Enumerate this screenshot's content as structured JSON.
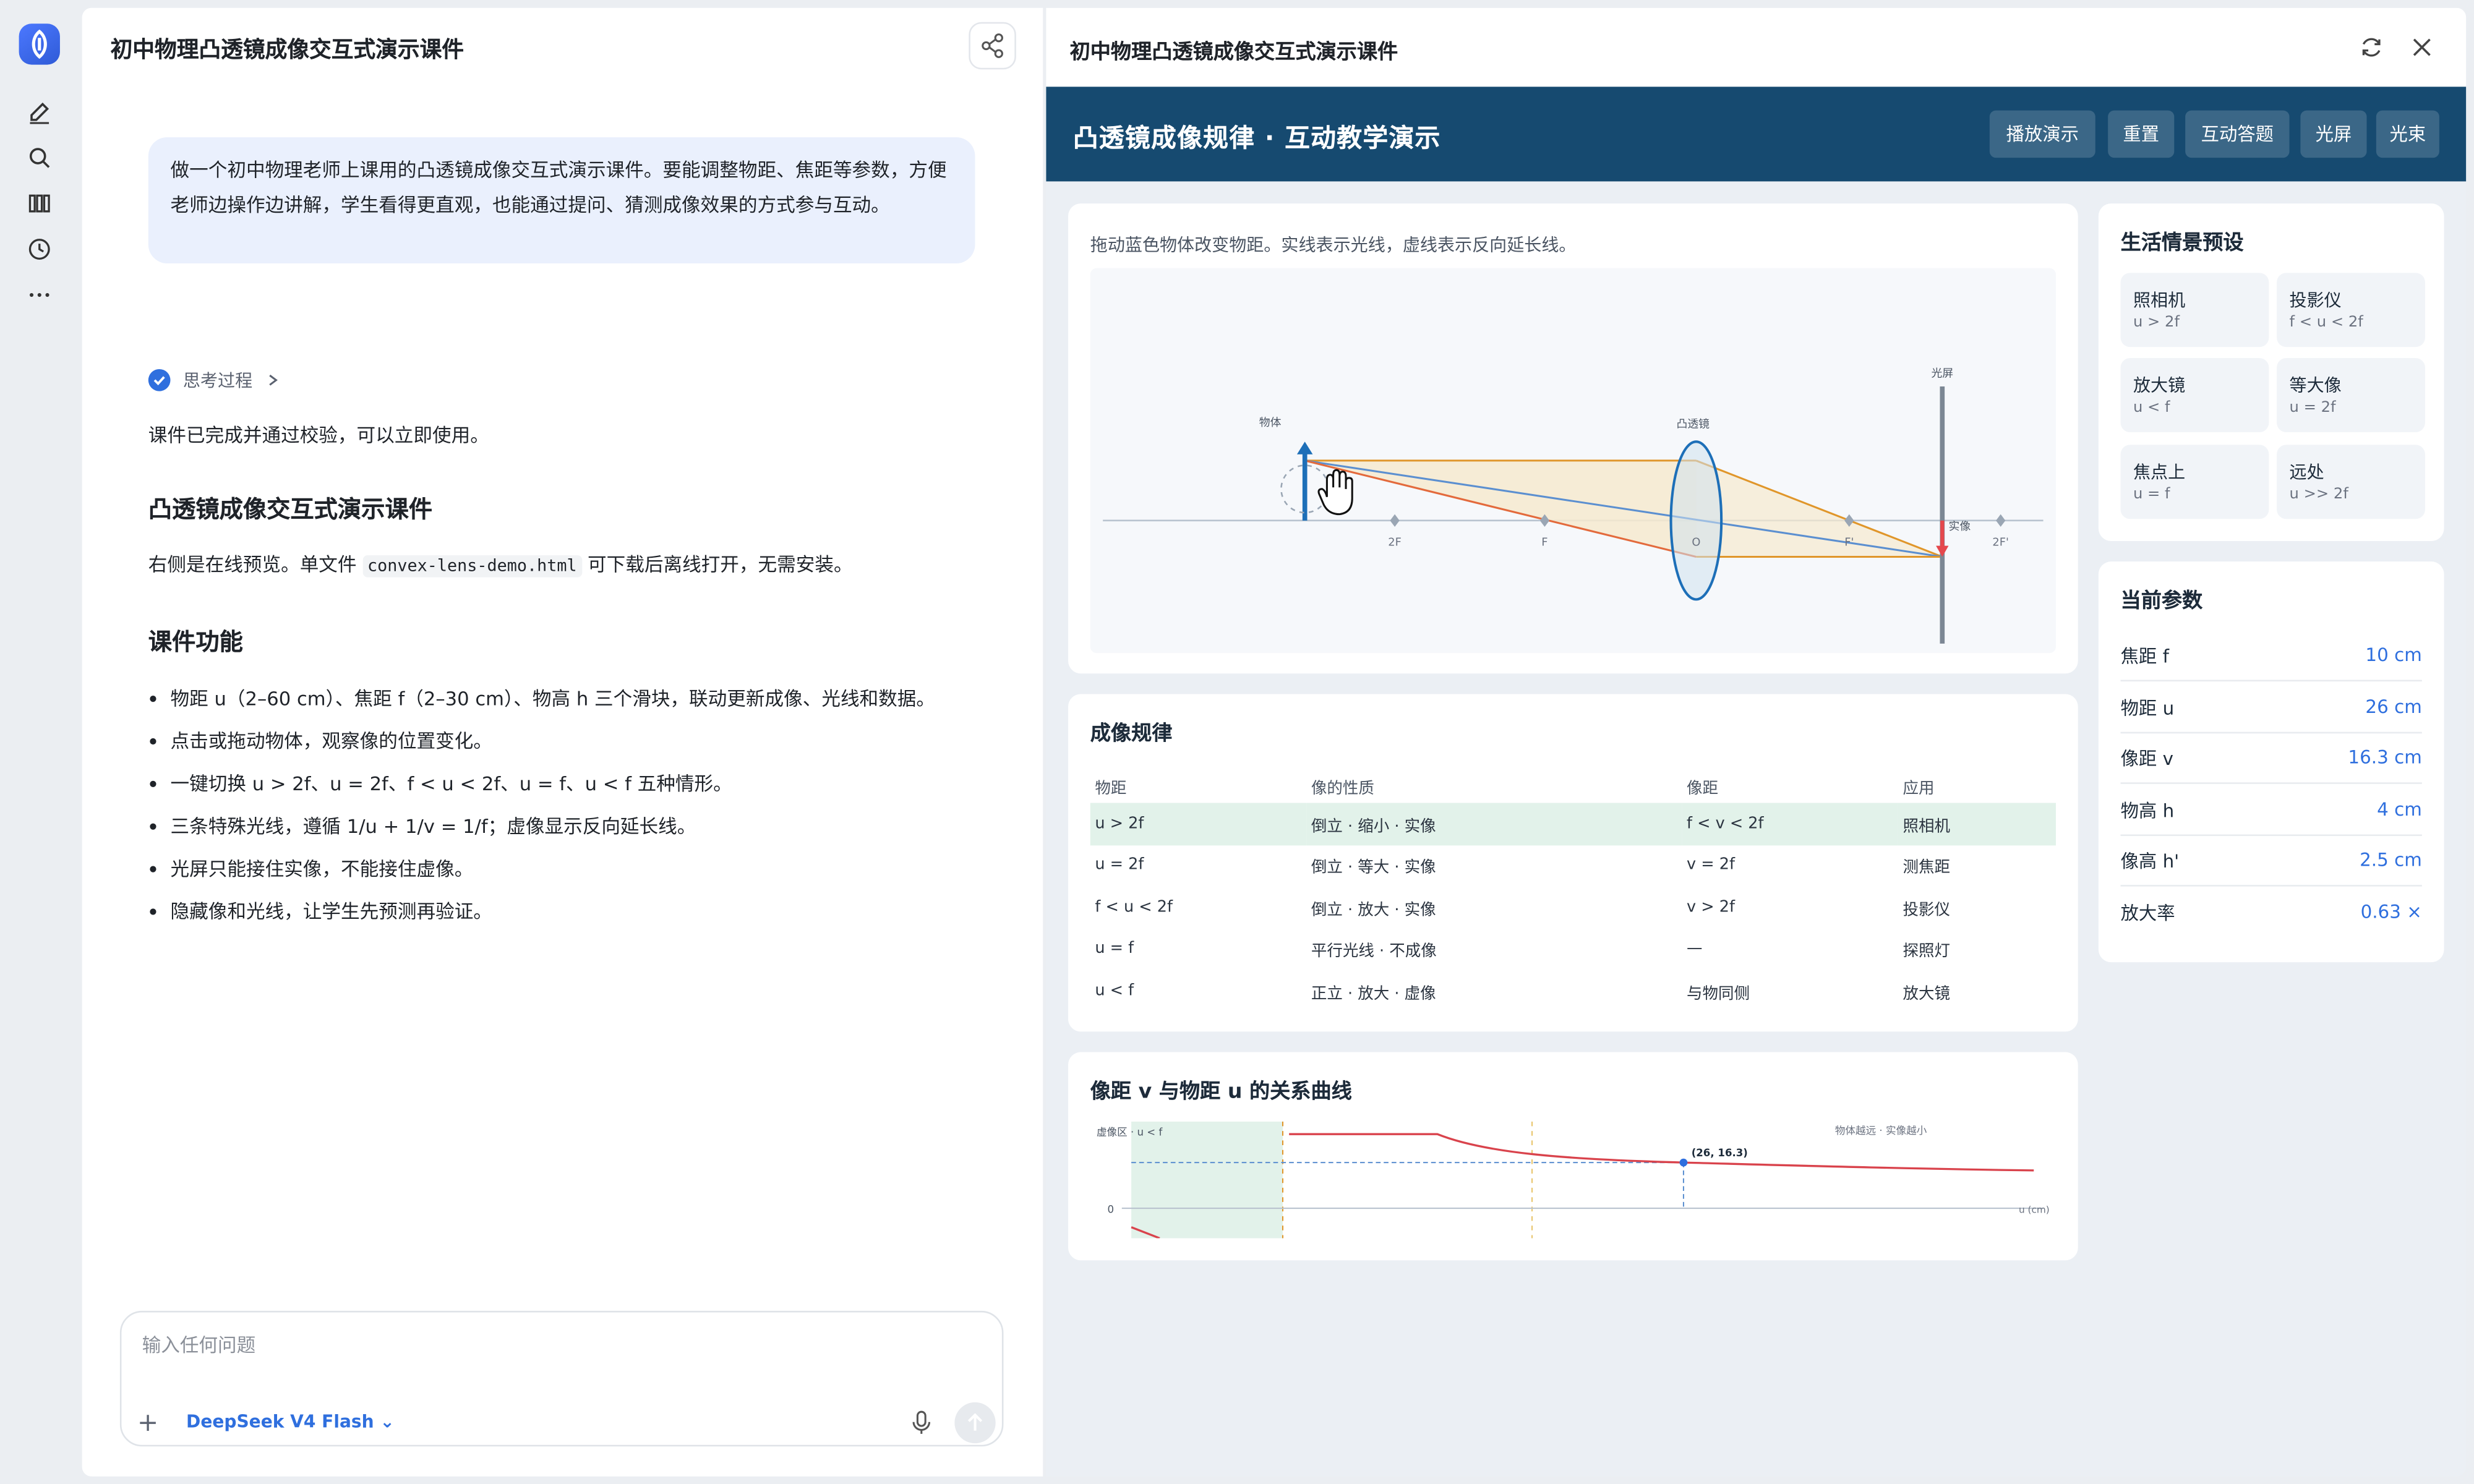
{
  "rail": {
    "icons": [
      "logo-icon",
      "edit-icon",
      "search-icon",
      "library-icon",
      "history-icon",
      "more-icon"
    ]
  },
  "chat": {
    "title": "初中物理凸透镜成像交互式演示课件",
    "user_message": "做一个初中物理老师上课用的凸透镜成像交互式演示课件。要能调整物距、焦距等参数，方便老师边操作边讲解，学生看得更直观，也能通过提问、猜测成像效果的方式参与互动。",
    "thinking_label": "思考过程",
    "status_line": "课件已完成并通过校验，可以立即使用。",
    "heading1": "凸透镜成像交互式演示课件",
    "preview_note_pre": "右侧是在线预览。单文件 ",
    "preview_note_file": "convex-lens-demo.html",
    "preview_note_post": " 可下载后离线打开，无需安装。",
    "heading2": "课件功能",
    "features": [
      "物距 u（2–60 cm）、焦距 f（2–30 cm）、物高 h 三个滑块，联动更新成像、光线和数据。",
      "点击或拖动物体，观察像的位置变化。",
      "一键切换 u > 2f、u = 2f、f < u < 2f、u = f、u < f 五种情形。",
      "三条特殊光线，遵循 1/u + 1/v = 1/f；虚像显示反向延长线。",
      "光屏只能接住实像，不能接住虚像。",
      "隐藏像和光线，让学生先预测再验证。"
    ],
    "composer_placeholder": "输入任何问题",
    "model_name": "DeepSeek V4 Flash"
  },
  "preview": {
    "title": "初中物理凸透镜成像交互式演示课件",
    "banner_title": "凸透镜成像规律 · 互动教学演示",
    "banner_buttons": [
      "播放演示",
      "重置",
      "互动答题",
      "光屏",
      "光束"
    ],
    "hint": "拖动蓝色物体改变物距。实线表示光线，虚线表示反向延长线。",
    "optics": {
      "labels": {
        "object": "物体",
        "lens": "凸透镜",
        "screen": "光屏",
        "image": "实像",
        "f2_left": "2F",
        "f_left": "F",
        "o": "O",
        "f_right": "F'",
        "f2_right": "2F'"
      }
    },
    "rules": {
      "title": "成像规律",
      "columns": [
        "物距",
        "像的性质",
        "像距",
        "应用"
      ],
      "rows": [
        [
          "u > 2f",
          "倒立 · 缩小 · 实像",
          "f < v < 2f",
          "照相机"
        ],
        [
          "u = 2f",
          "倒立 · 等大 · 实像",
          "v = 2f",
          "测焦距"
        ],
        [
          "f < u < 2f",
          "倒立 · 放大 · 实像",
          "v > 2f",
          "投影仪"
        ],
        [
          "u = f",
          "平行光线 · 不成像",
          "—",
          "探照灯"
        ],
        [
          "u < f",
          "正立 · 放大 · 虚像",
          "与物同侧",
          "放大镜"
        ]
      ]
    },
    "curve": {
      "title": "像距 v 与物距 u 的关系曲线",
      "virtual_zone_label": "虚像区 · u < f",
      "far_label": "物体越远 · 实像越小",
      "point_label": "(26, 16.3)",
      "zero_label": "0",
      "x_axis_label": "u (cm)"
    },
    "presets": {
      "title": "生活情景预设",
      "items": [
        {
          "name": "照相机",
          "cond": "u > 2f"
        },
        {
          "name": "投影仪",
          "cond": "f < u < 2f"
        },
        {
          "name": "放大镜",
          "cond": "u < f"
        },
        {
          "name": "等大像",
          "cond": "u = 2f"
        },
        {
          "name": "焦点上",
          "cond": "u = f"
        },
        {
          "name": "远处",
          "cond": "u >> 2f"
        }
      ]
    },
    "params": {
      "title": "当前参数",
      "rows": [
        {
          "key": "焦距 f",
          "value": "10 cm"
        },
        {
          "key": "物距 u",
          "value": "26 cm"
        },
        {
          "key": "像距 v",
          "value": "16.3 cm"
        },
        {
          "key": "物高 h",
          "value": "4 cm"
        },
        {
          "key": "像高 h'",
          "value": "2.5 cm"
        },
        {
          "key": "放大率",
          "value": "0.63 ×"
        }
      ]
    }
  },
  "colors": {
    "banner": "#164a70",
    "accent": "#2f6fde",
    "object": "#1d6fb8",
    "image": "#e5484d",
    "ray_orange": "#e0962a",
    "ray_blue": "#5b8fd0"
  }
}
